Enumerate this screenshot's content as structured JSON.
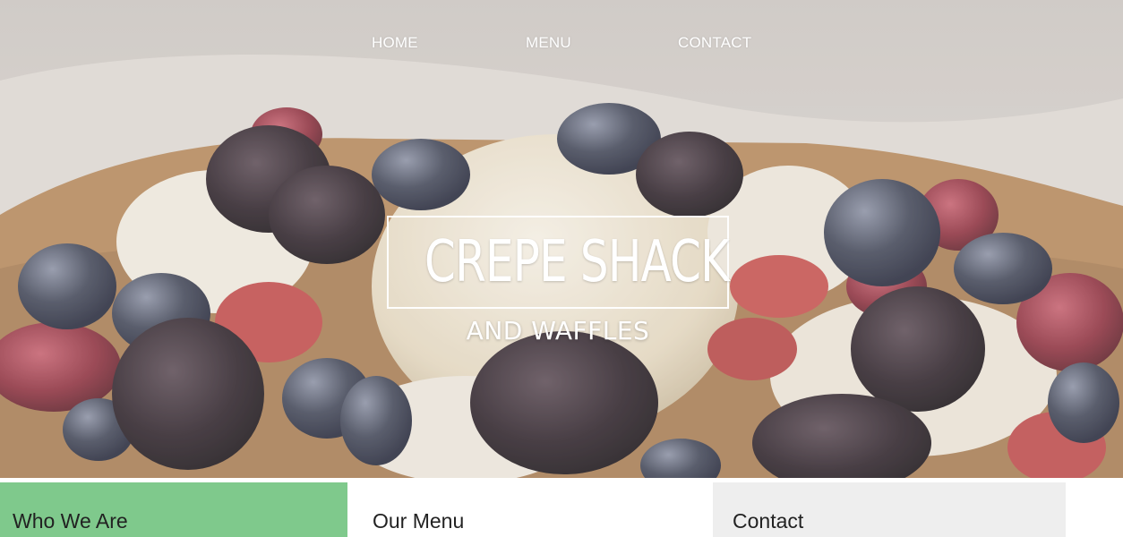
{
  "nav": {
    "items": [
      {
        "label": "HOME"
      },
      {
        "label": "MENU"
      },
      {
        "label": "CONTACT"
      }
    ]
  },
  "hero": {
    "title": "CREPE SHACK",
    "subtitle": "AND WAFFLES"
  },
  "sections": {
    "who": {
      "title": "Who We Are"
    },
    "menu": {
      "title": "Our Menu"
    },
    "contact": {
      "title": "Contact"
    }
  },
  "colors": {
    "who_bg": "#7fc98c",
    "contact_bg": "#eeeeee",
    "hero_overlay": "#d9d4cf"
  }
}
